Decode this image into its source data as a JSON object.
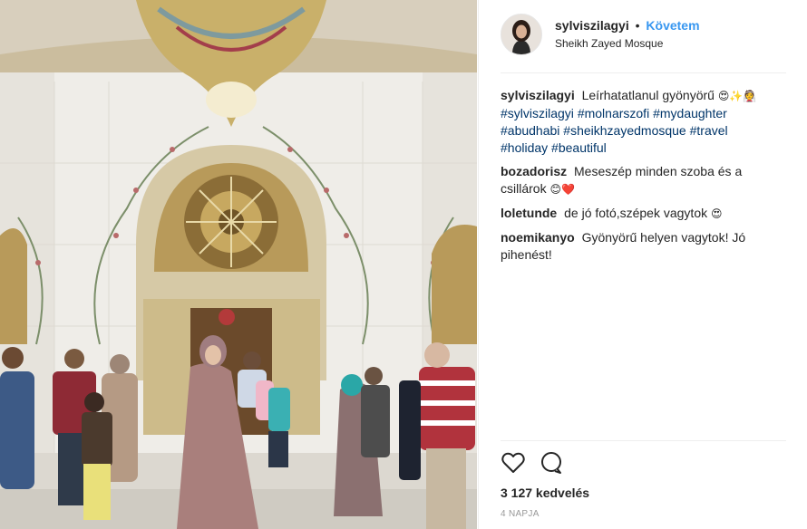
{
  "post": {
    "username": "sylviszilagyi",
    "dot": "•",
    "follow_label": "Követem",
    "location": "Sheikh Zayed Mosque",
    "image_description": "photo-sheikh-zayed-mosque"
  },
  "caption": {
    "username": "sylviszilagyi",
    "text": "Leírhatatlanul gyönyörű",
    "emojis": "😍✨👰",
    "hashtags": [
      "#sylviszilagyi",
      "#molnarszofi",
      "#mydaughter",
      "#abudhabi",
      "#sheikhzayedmosque",
      "#travel",
      "#holiday",
      "#beautiful"
    ]
  },
  "comments": [
    {
      "username": "bozadorisz",
      "text": "Meseszép minden szoba és a csillárok",
      "emoji": "😊❤️"
    },
    {
      "username": "loletunde",
      "text": "de jó fotó,szépek vagytok",
      "emoji": "😍"
    },
    {
      "username": "noemikanyo",
      "text": "Gyönyörű helyen vagytok! Jó pihenést!",
      "emoji": ""
    }
  ],
  "actions": {
    "like_icon": "heart-icon",
    "comment_icon": "comment-icon"
  },
  "likes_text": "3 127 kedvelés",
  "time_text": "4 NAPJA",
  "colors": {
    "link_blue": "#3897f0",
    "hashtag": "#003569",
    "text": "#262626",
    "muted": "#999999",
    "divider": "#efefef"
  }
}
